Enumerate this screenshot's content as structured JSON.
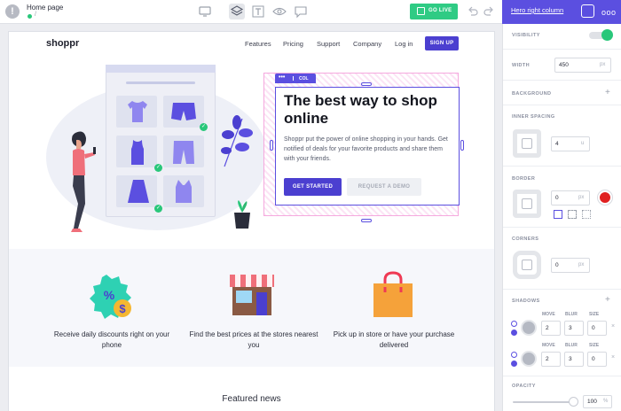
{
  "topbar": {
    "page_name": "Home page",
    "page_path": "/",
    "go_live": "GO LIVE"
  },
  "panel": {
    "title": "Hero right column",
    "more": "ooo",
    "visibility": "VISIBILITY",
    "width": "WIDTH",
    "width_value": "450",
    "width_unit": "px",
    "background": "BACKGROUND",
    "inner_spacing": "INNER SPACING",
    "inner_spacing_value": "4",
    "inner_spacing_unit": "u",
    "border": "BORDER",
    "border_value": "0",
    "border_unit": "px",
    "corners": "CORNERS",
    "corners_value": "0",
    "corners_unit": "px",
    "shadows": "SHADOWS",
    "shadow_cols": [
      "MOVE",
      "BLUR",
      "SIZE"
    ],
    "shadow_rows": [
      {
        "move": "2",
        "blur": "3",
        "size": "0"
      },
      {
        "move": "2",
        "blur": "3",
        "size": "0"
      }
    ],
    "opacity": "OPACITY",
    "opacity_value": "100",
    "opacity_unit": "%",
    "border_color": "#e02020",
    "accent": "#5b4fe0"
  },
  "site": {
    "logo": "shoppr",
    "nav": [
      "Features",
      "Pricing",
      "Support",
      "Company",
      "Log in"
    ],
    "signup": "SIGN UP",
    "hero_tag": "COL",
    "hero_title": "The best way to shop online",
    "hero_desc": "Shoppr put the power of online shopping in your hands. Get notified of deals for your favorite products and share them with your friends.",
    "btn_primary": "GET STARTED",
    "btn_secondary": "REQUEST A DEMO",
    "features": [
      "Receive daily discounts right on your phone",
      "Find the best prices at the stores nearest you",
      "Pick up in store or have your purchase delivered"
    ],
    "featured_news": "Featured news"
  }
}
